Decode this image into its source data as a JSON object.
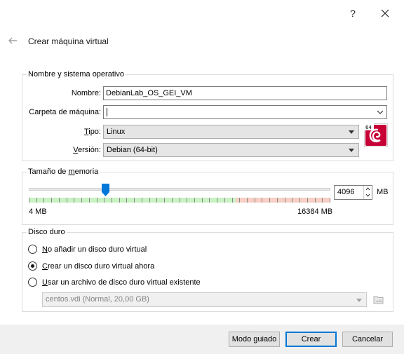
{
  "titlebar": {
    "help_label": "?"
  },
  "page_title": "Crear máquina virtual",
  "name_os": {
    "legend": "Nombre y sistema operativo",
    "name_label": "Nombre:",
    "name_value": "DebianLab_OS_GEI_VM",
    "folder_label": "Carpeta de máquina:",
    "folder_value": "",
    "type_label_u": "T",
    "type_label_rest": "ipo:",
    "type_value": "Linux",
    "version_label_u": "V",
    "version_label_rest": "ersión:",
    "version_value": "Debian (64-bit)",
    "os_icon": "debian-64-icon",
    "os_badge": "64"
  },
  "memory": {
    "legend_pre": "Tamaño de ",
    "legend_u": "m",
    "legend_post": "emoria",
    "min_label": "4 MB",
    "max_label": "16384 MB",
    "value": 4096,
    "value_text": "4096",
    "unit": "MB",
    "fraction": 0.25
  },
  "disk": {
    "legend": "Disco duro",
    "options": [
      {
        "u": "N",
        "rest": "o añadir un disco duro virtual",
        "checked": false
      },
      {
        "u": "C",
        "rest": "rear un disco duro virtual ahora",
        "checked": true
      },
      {
        "u": "U",
        "rest": "sar un archivo de disco duro virtual existente",
        "checked": false
      }
    ],
    "existing_file": "centos.vdi (Normal, 20,00 GB)"
  },
  "footer": {
    "guided_label": "Modo guiado",
    "create_label": "Crear",
    "cancel_label": "Cancelar"
  },
  "colors": {
    "slider_thumb": "#0078d7",
    "scale_safe": "#c8f2c2",
    "scale_warn": "#f7cfc4",
    "debian_red": "#c70036"
  }
}
